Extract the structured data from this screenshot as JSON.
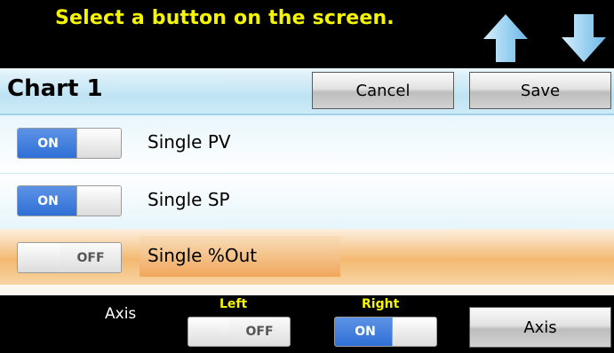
{
  "header": {
    "instruction": "Select a button on the screen.",
    "up_icon": "up-arrow-icon",
    "down_icon": "down-arrow-icon",
    "arrow_color": "#9ed3f2"
  },
  "title_bar": {
    "title": "Chart 1",
    "cancel_label": "Cancel",
    "save_label": "Save"
  },
  "rows": [
    {
      "label": "Single PV",
      "toggle": "ON"
    },
    {
      "label": "Single SP",
      "toggle": "ON"
    },
    {
      "label": "Single %Out",
      "toggle": "OFF"
    }
  ],
  "footer": {
    "axis_label": "Axis",
    "left_label": "Left",
    "left_toggle": "OFF",
    "right_label": "Right",
    "right_toggle": "ON",
    "axis_button_label": "Axis"
  },
  "colors": {
    "instruction_text": "#f5f500",
    "toggle_on": "#3f7fdd",
    "selected_row": "#f3b970"
  }
}
